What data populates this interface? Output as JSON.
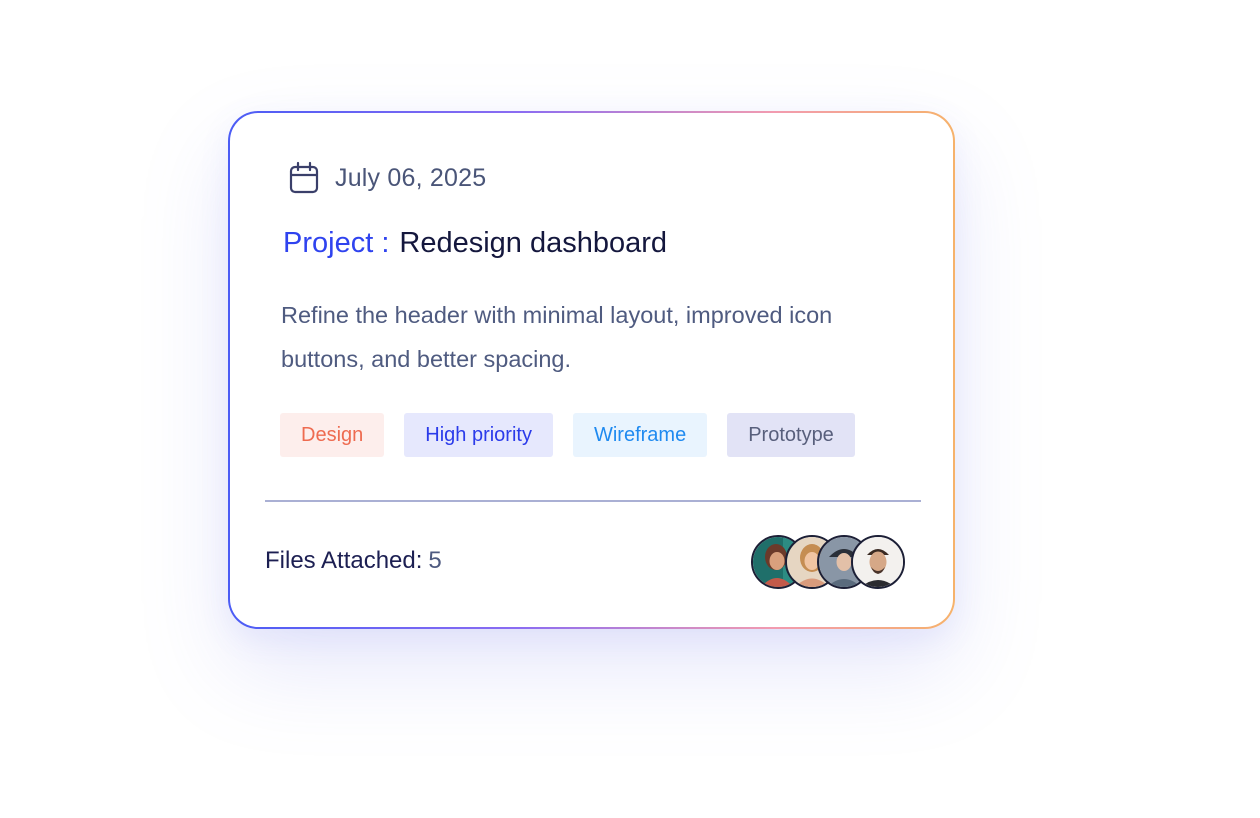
{
  "card": {
    "date": "July 06, 2025",
    "title_prefix": "Project :",
    "title": "Redesign dashboard",
    "description": "Refine the header with minimal layout, improved icon buttons, and better spacing.",
    "tags": [
      {
        "label": "Design",
        "color": "#ee6b50",
        "bg": "#fdeeec"
      },
      {
        "label": "High priority",
        "color": "#2b3bea",
        "bg": "#e6e8fd"
      },
      {
        "label": "Wireframe",
        "color": "#1f8af0",
        "bg": "#e9f4fe"
      },
      {
        "label": "Prototype",
        "color": "#585f7c",
        "bg": "#e2e3f6"
      }
    ],
    "files_label": "Files Attached:",
    "files_count": "5",
    "avatars": [
      {
        "name": "avatar-1",
        "icon": "person-avatar"
      },
      {
        "name": "avatar-2",
        "icon": "person-avatar"
      },
      {
        "name": "avatar-3",
        "icon": "person-avatar"
      },
      {
        "name": "avatar-4",
        "icon": "person-avatar"
      }
    ],
    "colors": {
      "accent": "#2f43ef",
      "title": "#14173d",
      "muted_text": "#4f5b80",
      "border_gradient": [
        "#4b5cf5",
        "#8b6cf2",
        "#f29bb0",
        "#f6b26b"
      ]
    },
    "icons": {
      "date": "calendar-icon"
    }
  }
}
